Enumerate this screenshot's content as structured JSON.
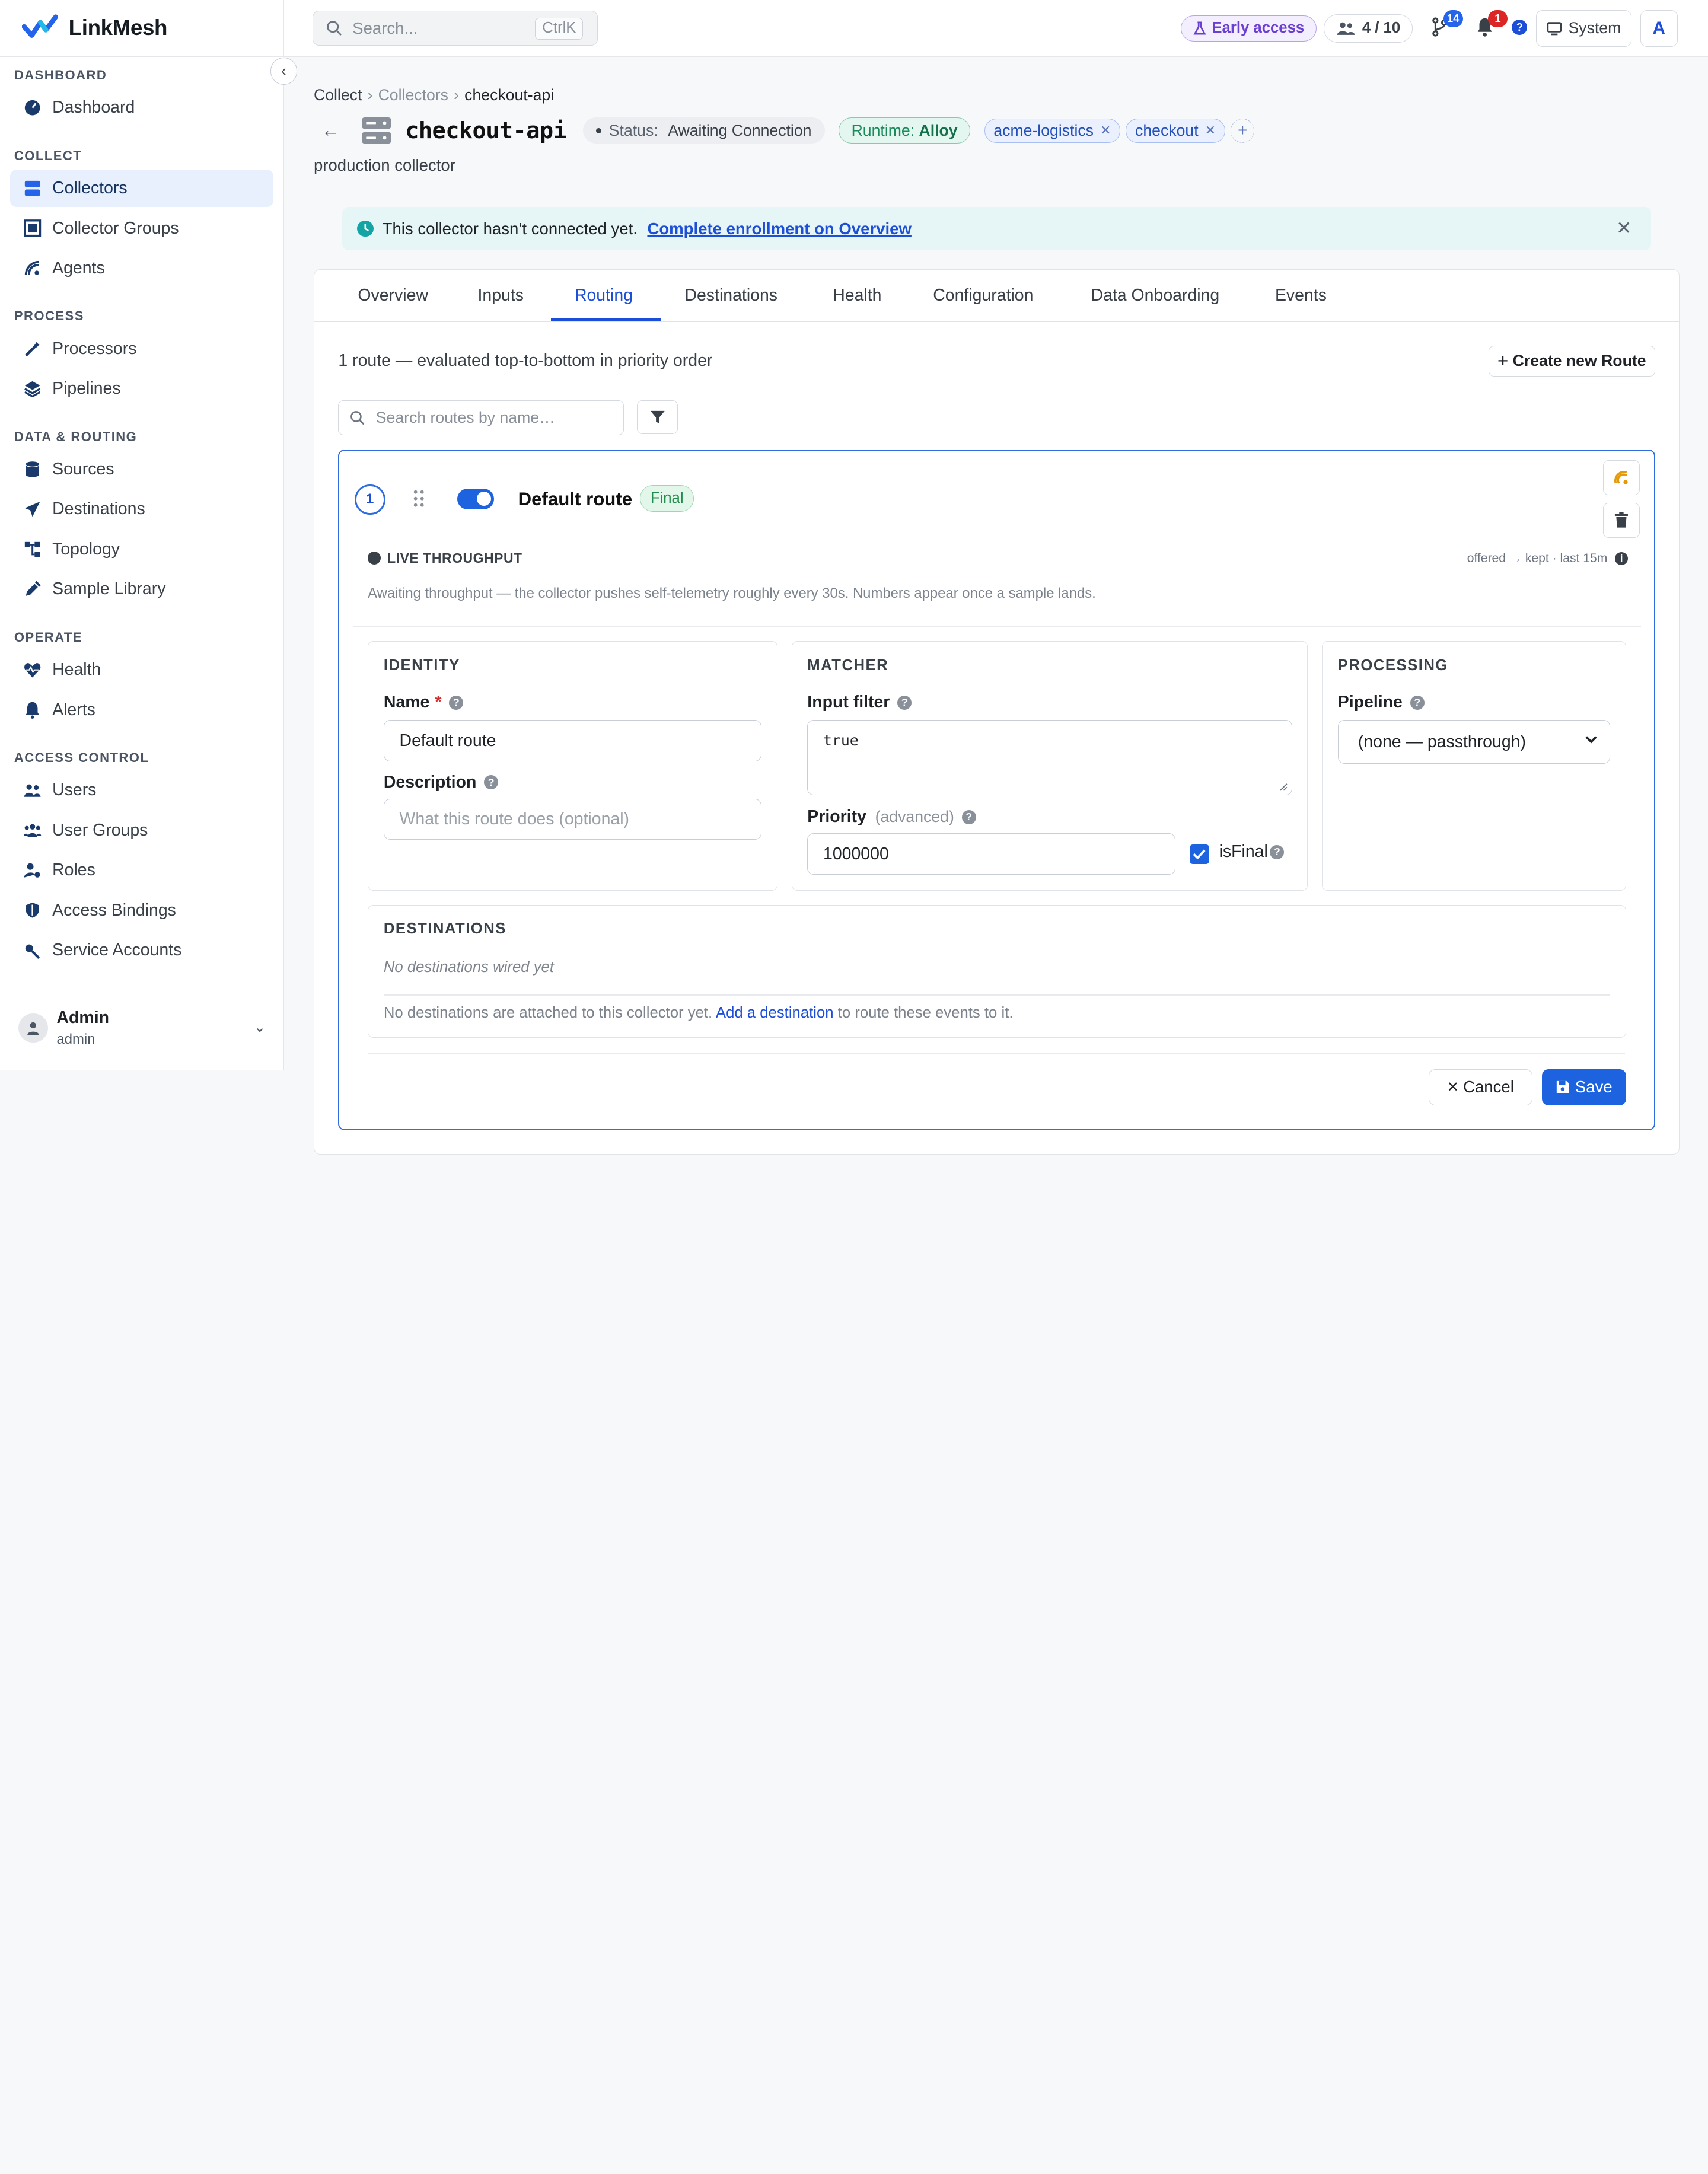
{
  "app": {
    "name": "LinkMesh"
  },
  "sidebar": {
    "sections": [
      {
        "title": "DASHBOARD",
        "items": [
          {
            "label": "Dashboard",
            "icon": "gauge-icon"
          }
        ]
      },
      {
        "title": "COLLECT",
        "items": [
          {
            "label": "Collectors",
            "icon": "server-icon",
            "active": true
          },
          {
            "label": "Collector Groups",
            "icon": "group-icon"
          },
          {
            "label": "Agents",
            "icon": "satellite-icon"
          }
        ]
      },
      {
        "title": "PROCESS",
        "items": [
          {
            "label": "Processors",
            "icon": "wand-icon"
          },
          {
            "label": "Pipelines",
            "icon": "layers-icon"
          }
        ]
      },
      {
        "title": "DATA & ROUTING",
        "items": [
          {
            "label": "Sources",
            "icon": "database-icon"
          },
          {
            "label": "Destinations",
            "icon": "paper-plane-icon"
          },
          {
            "label": "Topology",
            "icon": "topology-icon"
          },
          {
            "label": "Sample Library",
            "icon": "eyedropper-icon"
          }
        ]
      },
      {
        "title": "OPERATE",
        "items": [
          {
            "label": "Health",
            "icon": "heartbeat-icon"
          },
          {
            "label": "Alerts",
            "icon": "bell-icon"
          }
        ]
      },
      {
        "title": "ACCESS CONTROL",
        "items": [
          {
            "label": "Users",
            "icon": "users-icon"
          },
          {
            "label": "User Groups",
            "icon": "user-group-icon"
          },
          {
            "label": "Roles",
            "icon": "user-gear-icon"
          },
          {
            "label": "Access Bindings",
            "icon": "shield-icon"
          },
          {
            "label": "Service Accounts",
            "icon": "key-icon"
          }
        ]
      }
    ],
    "user": {
      "name": "Admin",
      "role": "admin"
    }
  },
  "topbar": {
    "search_placeholder": "Search...",
    "search_shortcut": "CtrlK",
    "early_access": "Early access",
    "seats": "4 / 10",
    "git_badge": "14",
    "alerts_badge": "1",
    "help": "?",
    "theme": "System",
    "avatar": "A"
  },
  "page": {
    "breadcrumb": [
      "Collect",
      "Collectors",
      "checkout-api"
    ],
    "title": "checkout-api",
    "status_label": "Status:",
    "status_value": "Awaiting Connection",
    "runtime_label": "Runtime:",
    "runtime_value": "Alloy",
    "tags": [
      "acme-logistics",
      "checkout"
    ],
    "subtitle": "production collector"
  },
  "banner": {
    "message": "This collector hasn’t connected yet.",
    "link": "Complete enrollment on Overview"
  },
  "tabs": [
    "Overview",
    "Inputs",
    "Routing",
    "Destinations",
    "Health",
    "Configuration",
    "Data Onboarding",
    "Events"
  ],
  "active_tab": "Routing",
  "routing": {
    "summary": "1 route — evaluated top-to-bottom in priority order",
    "create_button": "Create new Route",
    "search_placeholder": "Search routes by name…"
  },
  "route": {
    "priority_index": "1",
    "enabled": true,
    "name": "Default route",
    "final_badge": "Final",
    "live": {
      "title": "LIVE THROUGHPUT",
      "meta": "offered → kept · last 15m",
      "description": "Awaiting throughput — the collector pushes self-telemetry roughly every 30s. Numbers appear once a sample lands."
    },
    "identity": {
      "title": "IDENTITY",
      "name_label": "Name",
      "name_value": "Default route",
      "description_label": "Description",
      "description_placeholder": "What this route does (optional)"
    },
    "matcher": {
      "title": "MATCHER",
      "filter_label": "Input filter",
      "filter_value": "true",
      "priority_label": "Priority",
      "priority_hint": "(advanced)",
      "priority_value": "1000000",
      "is_final_label": "isFinal",
      "is_final": true
    },
    "processing": {
      "title": "PROCESSING",
      "pipeline_label": "Pipeline",
      "pipeline_value": "(none — passthrough)"
    },
    "destinations": {
      "title": "DESTINATIONS",
      "empty": "No destinations wired yet",
      "msg_before": "No destinations are attached to this collector yet.",
      "msg_link": "Add a destination",
      "msg_after": "to route these events to it."
    },
    "cancel": "Cancel",
    "save": "Save"
  },
  "colors": {
    "accent": "#1d63e0",
    "success": "#1f8a4c",
    "teal": "#14a4a4",
    "purple": "#6b3fd0"
  }
}
